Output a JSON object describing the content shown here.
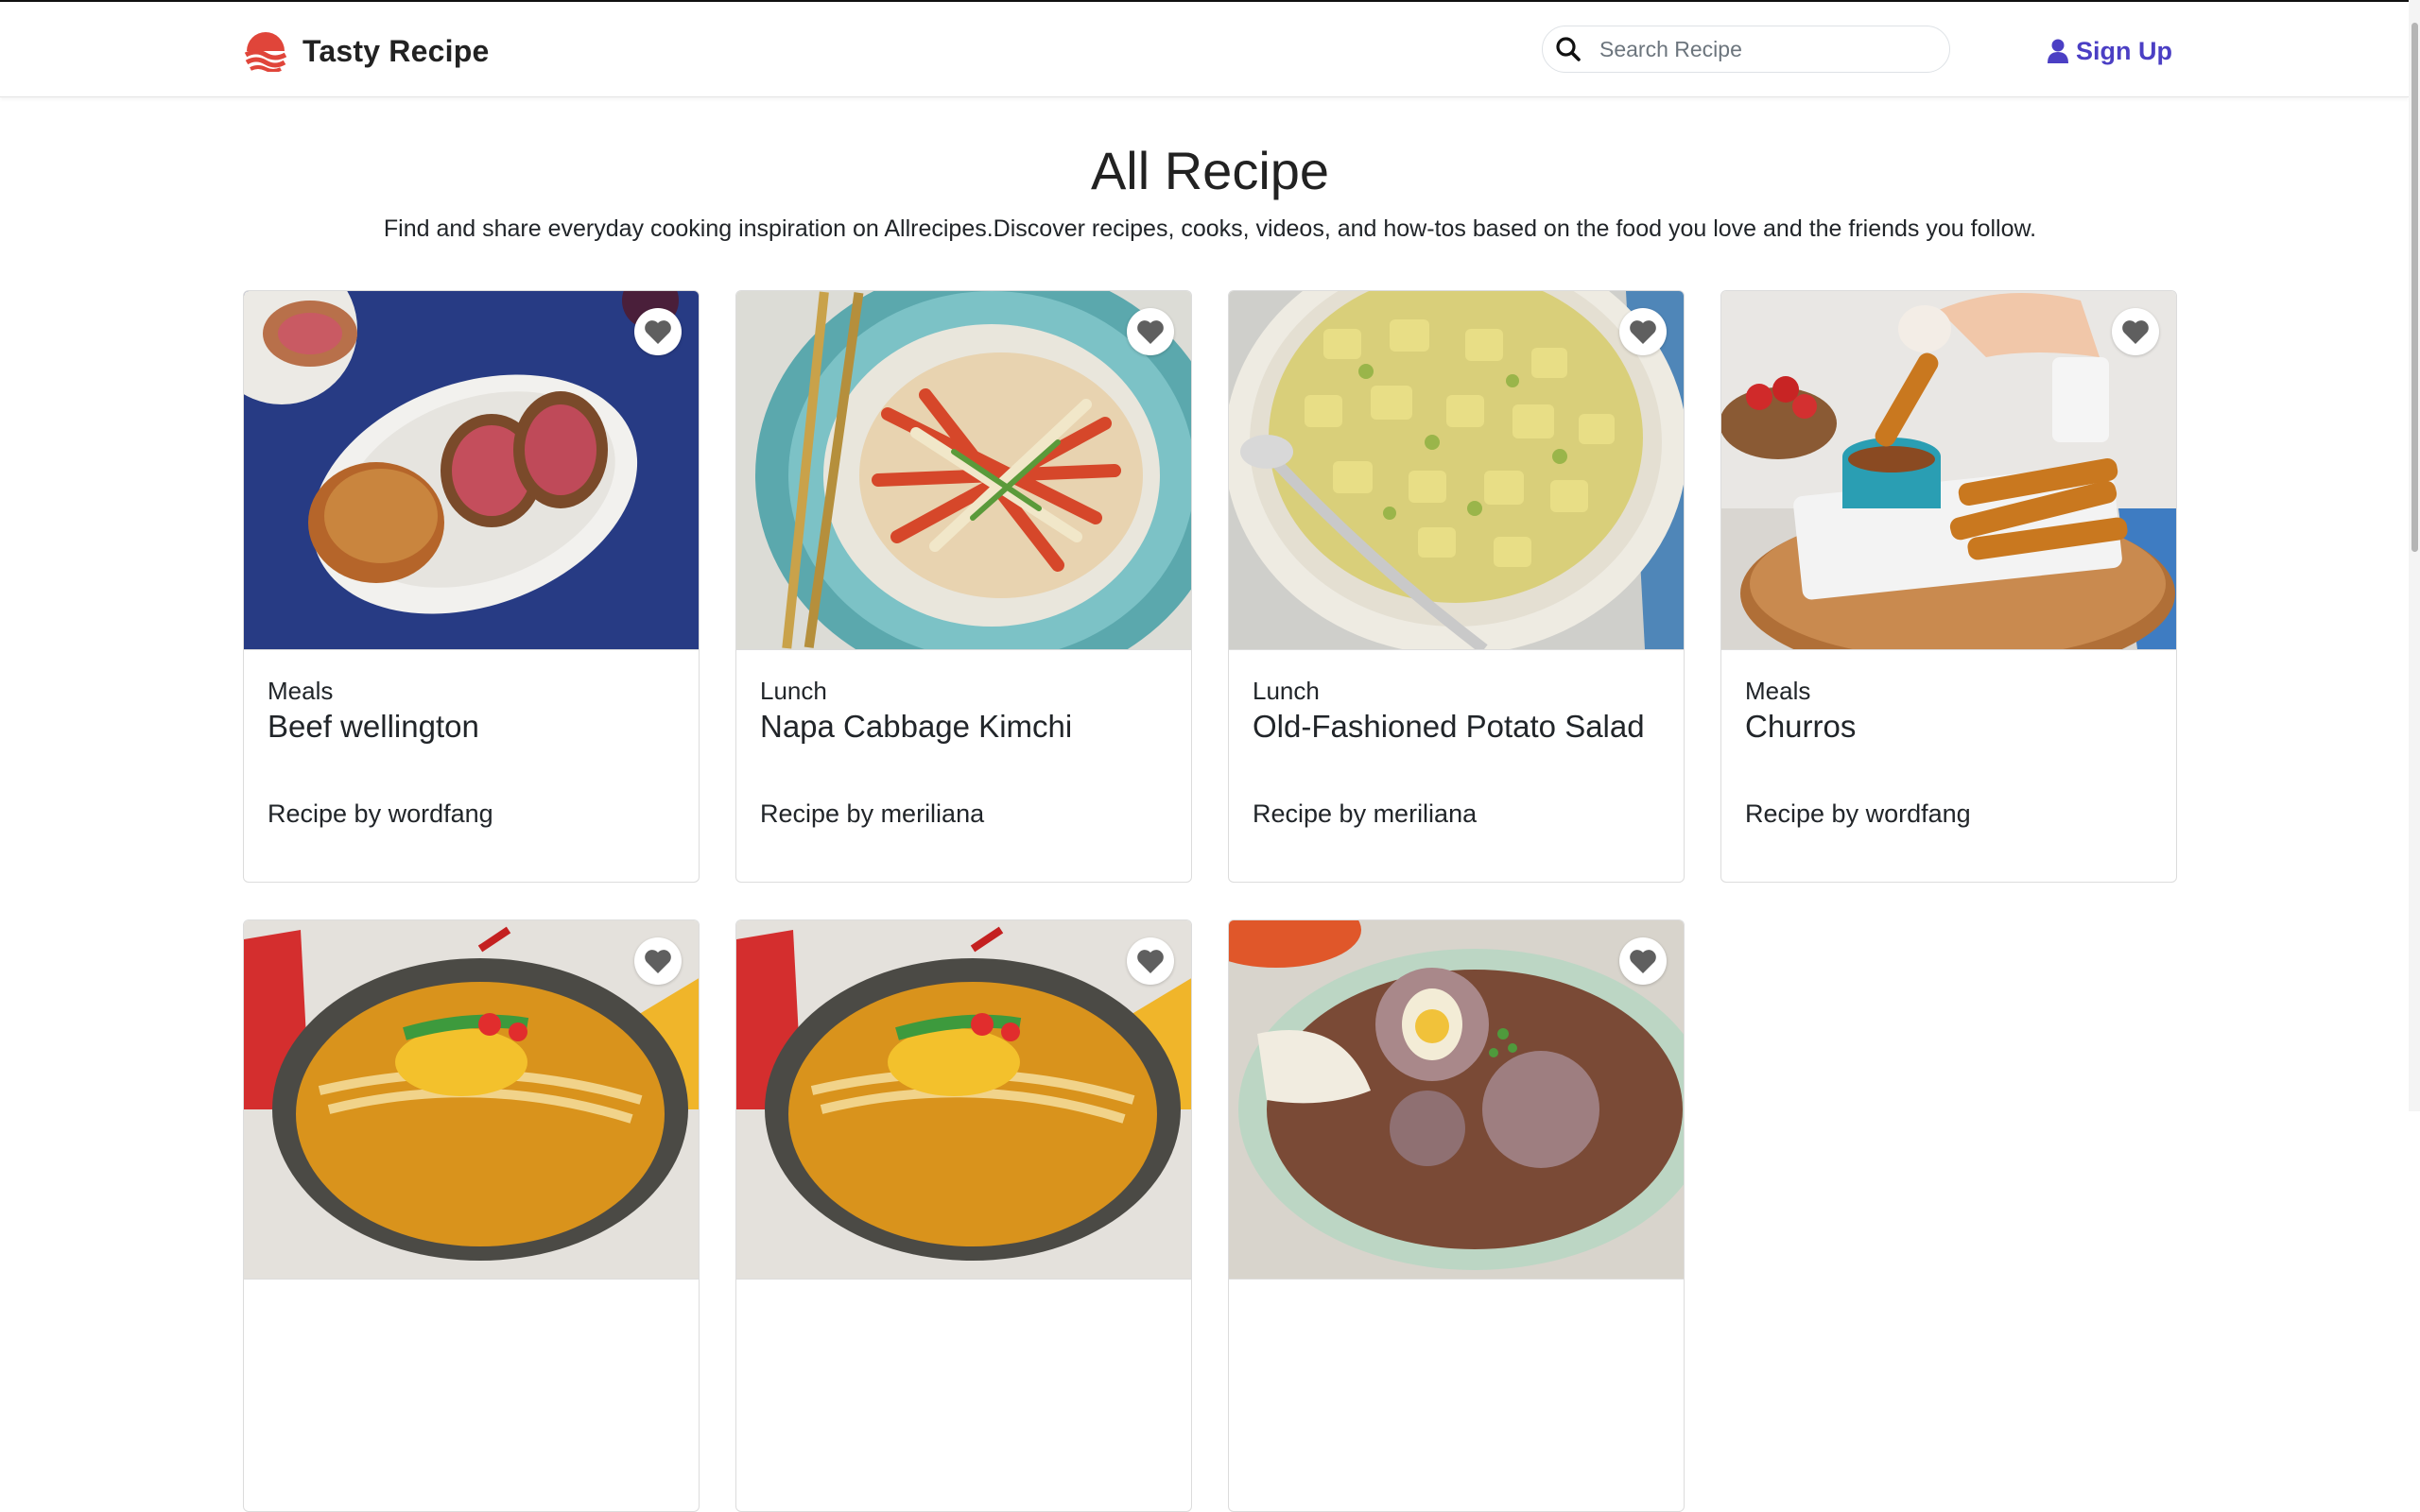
{
  "brand": {
    "name": "Tasty Recipe",
    "logo_icon": "striped-bowl-logo",
    "color": "#e0453a"
  },
  "search": {
    "placeholder": "Search Recipe",
    "value": ""
  },
  "nav": {
    "signup_label": "Sign Up",
    "accent_color": "#4b3fc4"
  },
  "page": {
    "title": "All Recipe",
    "subtitle": "Find and share everyday cooking inspiration on Allrecipes.Discover recipes, cooks, videos, and how-tos based on the food you love and the friends you follow."
  },
  "recipes": [
    {
      "category": "Meals",
      "title": "Beef wellington",
      "author": "Recipe by wordfang",
      "image": "beef-wellington-photo"
    },
    {
      "category": "Lunch",
      "title": "Napa Cabbage Kimchi",
      "author": "Recipe by meriliana",
      "image": "kimchi-photo"
    },
    {
      "category": "Lunch",
      "title": "Old-Fashioned Potato Salad",
      "author": "Recipe by meriliana",
      "image": "potato-salad-photo"
    },
    {
      "category": "Meals",
      "title": "Churros",
      "author": "Recipe by wordfang",
      "image": "churros-photo"
    },
    {
      "image": "ramen-photo"
    },
    {
      "image": "ramen-photo"
    },
    {
      "image": "meatball-soup-photo"
    }
  ]
}
